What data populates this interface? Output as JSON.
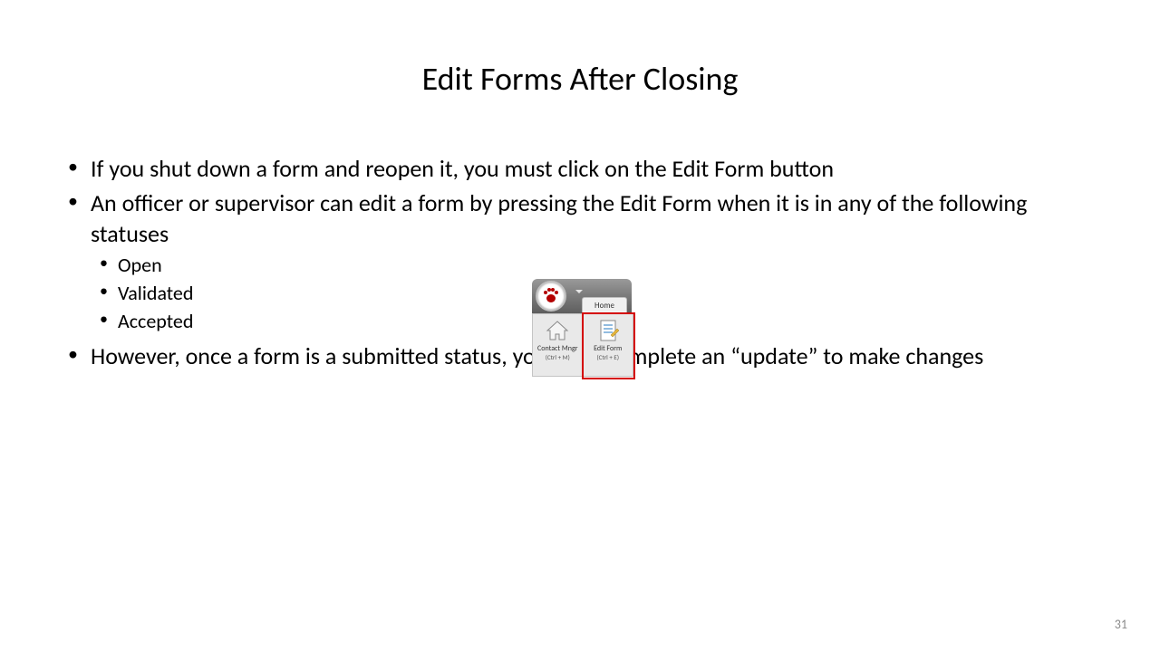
{
  "title": "Edit Forms After Closing",
  "bullets": [
    {
      "text": "If you shut down a form and reopen it, you must click on the Edit Form button"
    },
    {
      "text": "An officer or supervisor can edit a form by pressing the Edit Form when it is in any of the following statuses",
      "sub": [
        "Open",
        "Validated",
        "Accepted"
      ]
    },
    {
      "text": "However, once a form is a submitted status, you must complete an “update” to make changes"
    }
  ],
  "ribbon": {
    "tab": "Home",
    "buttons": [
      {
        "label": "Contact Mngr",
        "shortcut": "(Ctrl + M)"
      },
      {
        "label": "Edit Form",
        "shortcut": "(Ctrl + E)"
      }
    ]
  },
  "pageNumber": "31"
}
